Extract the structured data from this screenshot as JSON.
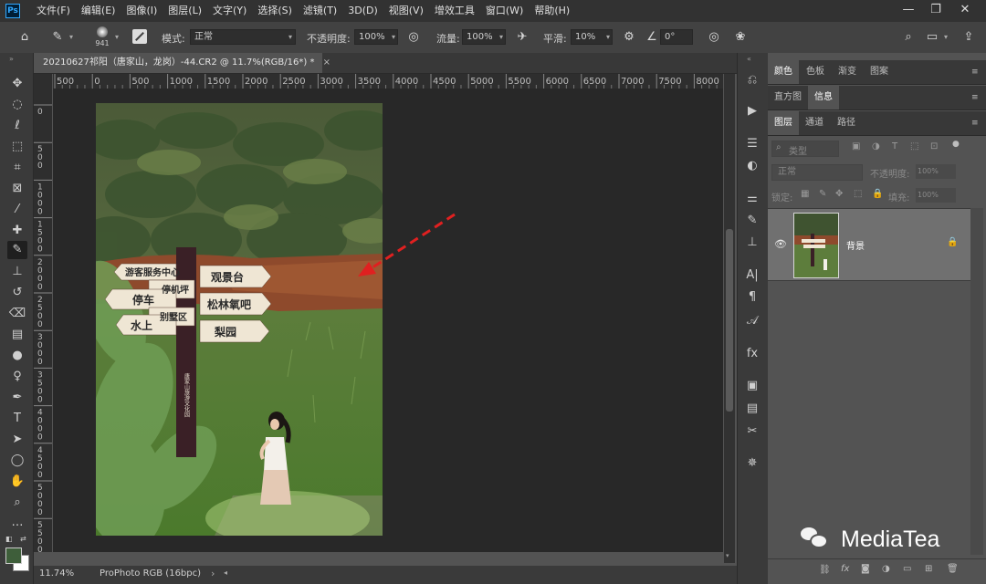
{
  "menubar": {
    "logo": "Ps",
    "items": [
      "文件(F)",
      "编辑(E)",
      "图像(I)",
      "图层(L)",
      "文字(Y)",
      "选择(S)",
      "滤镜(T)",
      "3D(D)",
      "视图(V)",
      "增效工具",
      "窗口(W)",
      "帮助(H)"
    ],
    "minimize": "—",
    "restore": "❐",
    "close": "✕"
  },
  "options": {
    "brush_size": "941",
    "mode_label": "模式:",
    "mode_value": "正常",
    "opacity_label": "不透明度:",
    "opacity_value": "100%",
    "flow_label": "流量:",
    "flow_value": "100%",
    "smooth_label": "平滑:",
    "smooth_value": "10%",
    "angle_value": "0°"
  },
  "document": {
    "tab_title": "20210627祁阳（唐家山，龙岗）-44.CR2 @ 11.7%(RGB/16*) *",
    "tab_close": "×",
    "hruler_ticks": [
      "500",
      "0",
      "500",
      "1000",
      "1500",
      "2000",
      "2500",
      "3000",
      "3500",
      "4000",
      "4500",
      "5000",
      "5500",
      "6000",
      "6500",
      "7000",
      "7500",
      "8000"
    ],
    "vruler_ticks": [
      "0",
      "500",
      "1000",
      "1500",
      "2000",
      "2500",
      "3000",
      "3500",
      "4000",
      "4500",
      "5000",
      "5500"
    ],
    "zoom": "11.74%",
    "profile": "ProPhoto RGB (16bpc)",
    "status_arrow": "›"
  },
  "photo": {
    "sign_top_left": "游客服务中心",
    "sign_top_right": "观景台",
    "sign_mid_left_1": "停机坪",
    "sign_mid_left_2": "停车",
    "sign_mid_left_3": "别墅区",
    "sign_mid_right": "松林氧吧",
    "sign_bottom_left": "水上",
    "sign_bottom_right": "梨园",
    "post_text": "唐家山旅游文化园"
  },
  "panels": {
    "tabs1": [
      "颜色",
      "色板",
      "渐变",
      "图案"
    ],
    "tabs2": [
      "直方图",
      "信息"
    ],
    "tabs3": [
      "图层",
      "通道",
      "路径"
    ],
    "search_placeholder": "类型",
    "blend_mode": "正常",
    "opacity_label": "不透明度:",
    "opacity_value": "100%",
    "lock_label": "锁定:",
    "fill_label": "填充:",
    "fill_value": "100%",
    "layer_name": "背景"
  },
  "watermark": "MediaTea",
  "colors": {
    "foreground": "#3e5e3a",
    "background": "#ffffff",
    "arrow": "#e02020"
  }
}
